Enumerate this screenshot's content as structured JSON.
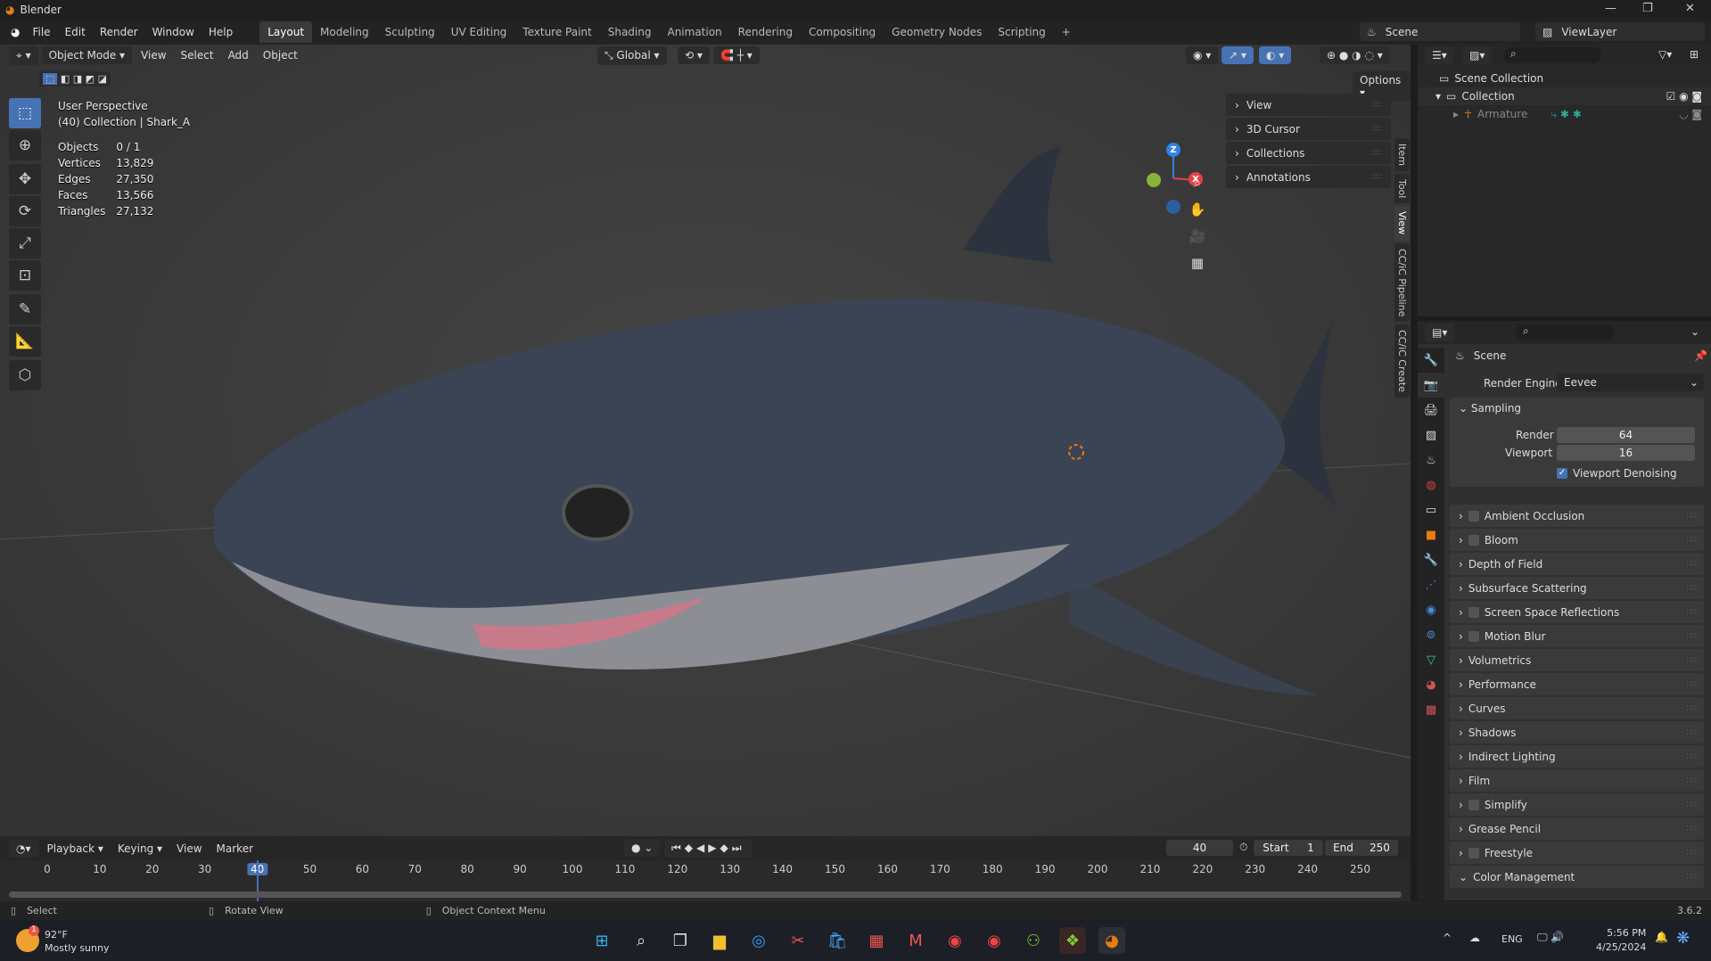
{
  "window": {
    "title": "Blender",
    "version": "3.6.2"
  },
  "menu": [
    "File",
    "Edit",
    "Render",
    "Window",
    "Help"
  ],
  "workspaces": [
    "Layout",
    "Modeling",
    "Sculpting",
    "UV Editing",
    "Texture Paint",
    "Shading",
    "Animation",
    "Rendering",
    "Compositing",
    "Geometry Nodes",
    "Scripting"
  ],
  "scene": {
    "name": "Scene",
    "view_layer": "ViewLayer"
  },
  "viewport": {
    "mode": "Object Mode",
    "menus": [
      "View",
      "Select",
      "Add",
      "Object"
    ],
    "orientation": "Global",
    "options": "Options",
    "overlay_title": "User Perspective",
    "overlay_sub": "(40) Collection | Shark_A",
    "stats": [
      {
        "label": "Objects",
        "value": "0 / 1"
      },
      {
        "label": "Vertices",
        "value": "13,829"
      },
      {
        "label": "Edges",
        "value": "27,350"
      },
      {
        "label": "Faces",
        "value": "13,566"
      },
      {
        "label": "Triangles",
        "value": "27,132"
      }
    ],
    "gizmo": {
      "z": "Z",
      "x": "X"
    },
    "npanel": [
      "View",
      "3D Cursor",
      "Collections",
      "Annotations"
    ],
    "ntabs": [
      "Item",
      "Tool",
      "View",
      "CC/iC Pipeline",
      "CC/iC Create"
    ],
    "active_ntab": "View"
  },
  "outliner": {
    "root": "Scene Collection",
    "collection": "Collection",
    "child": "Armature"
  },
  "properties": {
    "context": "Scene",
    "render_engine_label": "Render Engine",
    "render_engine": "Eevee",
    "sampling": {
      "title": "Sampling",
      "render_label": "Render",
      "render": "64",
      "viewport_label": "Viewport",
      "viewport": "16",
      "denoise": "Viewport Denoising"
    },
    "panels": [
      {
        "label": "Ambient Occlusion",
        "checkbox": true
      },
      {
        "label": "Bloom",
        "checkbox": true
      },
      {
        "label": "Depth of Field",
        "checkbox": false
      },
      {
        "label": "Subsurface Scattering",
        "checkbox": false
      },
      {
        "label": "Screen Space Reflections",
        "checkbox": true
      },
      {
        "label": "Motion Blur",
        "checkbox": true
      },
      {
        "label": "Volumetrics",
        "checkbox": false
      },
      {
        "label": "Performance",
        "checkbox": false
      },
      {
        "label": "Curves",
        "checkbox": false
      },
      {
        "label": "Shadows",
        "checkbox": false
      },
      {
        "label": "Indirect Lighting",
        "checkbox": false
      },
      {
        "label": "Film",
        "checkbox": false
      },
      {
        "label": "Simplify",
        "checkbox": true
      },
      {
        "label": "Grease Pencil",
        "checkbox": false
      },
      {
        "label": "Freestyle",
        "checkbox": true
      },
      {
        "label": "Color Management",
        "checkbox": false,
        "expanded": true
      }
    ]
  },
  "timeline": {
    "menus": [
      "Playback",
      "Keying",
      "View",
      "Marker"
    ],
    "current_frame": "40",
    "start_label": "Start",
    "start": "1",
    "end_label": "End",
    "end": "250",
    "ticks": [
      "0",
      "10",
      "20",
      "30",
      "40",
      "50",
      "60",
      "70",
      "80",
      "90",
      "100",
      "110",
      "120",
      "130",
      "140",
      "150",
      "160",
      "170",
      "180",
      "190",
      "200",
      "210",
      "220",
      "230",
      "240",
      "250"
    ]
  },
  "statusbar": {
    "select": "Select",
    "rotate": "Rotate View",
    "context": "Object Context Menu"
  },
  "taskbar": {
    "temp": "92°F",
    "weather": "Mostly sunny",
    "weather_badge": "1",
    "lang": "ENG",
    "time": "5:56 PM",
    "date": "4/25/2024"
  },
  "colors": {
    "accent": "#4772b3",
    "blender_orange": "#e87d0d",
    "axis_x": "#e0424b",
    "axis_y": "#8ab33a",
    "axis_z": "#2f83e3"
  }
}
